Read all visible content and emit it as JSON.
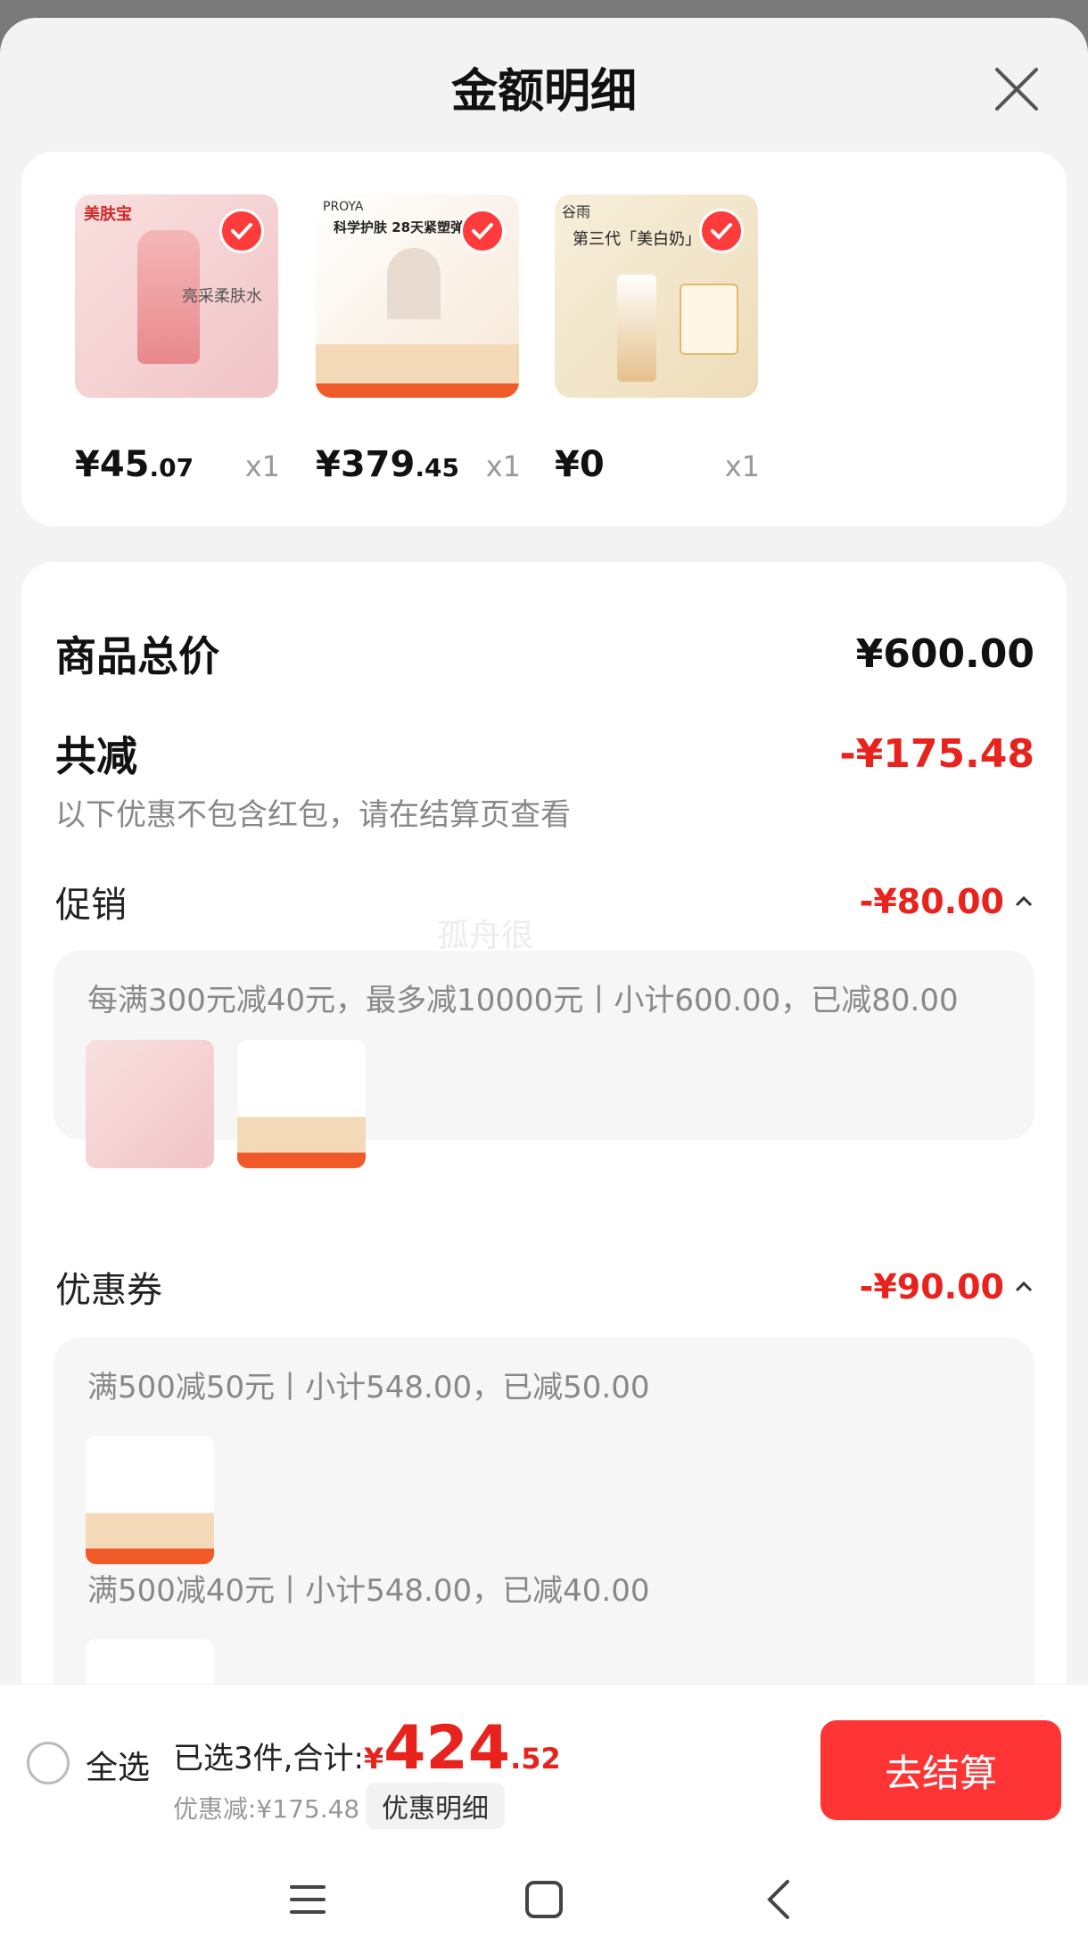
{
  "header": {
    "title": "金额明细"
  },
  "products": [
    {
      "brand": "美肤宝",
      "tagline": "亮采柔肤水",
      "price_int": "¥45",
      "price_dec": ".07",
      "qty": "x1",
      "color": "#f7d3d4"
    },
    {
      "brand": "PROYA",
      "tagline": "科学护肤 28天紧塑弹",
      "price_int": "¥379",
      "price_dec": ".45",
      "qty": "x1",
      "color": "#fbeedd"
    },
    {
      "brand": "谷雨",
      "tagline": "第三代「美白奶」",
      "price_int": "¥0",
      "price_dec": "",
      "qty": "x1",
      "color": "#f5ead2"
    }
  ],
  "summary": {
    "total_label": "商品总价",
    "total_value": "¥600.00",
    "discount_label": "共减",
    "discount_value": "-¥175.48",
    "discount_note": "以下优惠不包含红包，请在结算页查看"
  },
  "promo": {
    "label": "促销",
    "value": "-¥80.00",
    "rule": "每满300元减40元，最多减10000元丨小计600.00，已减80.00"
  },
  "coupon": {
    "label": "优惠券",
    "value": "-¥90.00",
    "rule1": "满500减50元丨小计548.00，已减50.00",
    "rule2": "满500减40元丨小计548.00，已减40.00"
  },
  "watermark": "孤舟很",
  "bottom": {
    "select_all": "全选",
    "selected_text": "已选3件,合计:",
    "currency": "¥",
    "total_int": "424",
    "total_dec": ".52",
    "discount": "优惠减:¥175.48",
    "detail_button": "优惠明细",
    "checkout_button": "去结算"
  },
  "colors": {
    "accent_red": "#e8231e",
    "button_red": "#ff3535"
  }
}
